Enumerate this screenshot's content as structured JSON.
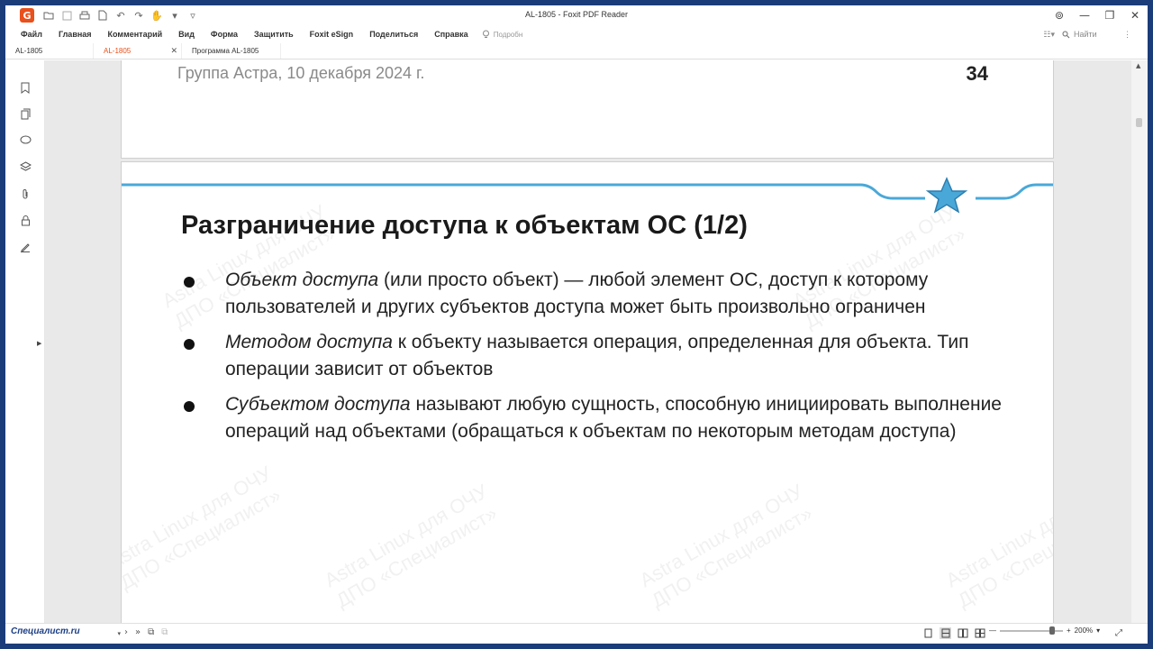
{
  "window": {
    "title": "AL-1805 - Foxit PDF Reader",
    "app_logo_letter": "G"
  },
  "menu": {
    "items": [
      "Файл",
      "Главная",
      "Комментарий",
      "Вид",
      "Форма",
      "Защитить",
      "Foxit eSign",
      "Поделиться",
      "Справка"
    ],
    "tell_me": "Подробн",
    "find_placeholder": "Найти"
  },
  "tabs": [
    {
      "label": "AL-1805",
      "active": false
    },
    {
      "label": "AL-1805",
      "active": true
    },
    {
      "label": "Программа AL-1805",
      "active": false
    }
  ],
  "document": {
    "prev_page": {
      "header_left": "Группа Астра, 10 декабря 2024 г.",
      "page_number": "34"
    },
    "slide": {
      "title": "Разграничение доступа к объектам ОС (1/2)",
      "bullets": [
        {
          "term": "Объект доступа",
          "text": " (или просто объект) — любой элемент ОС, доступ к которому пользователей и других субъектов доступа может быть произвольно ограничен"
        },
        {
          "term": "Методом доступа",
          "text": " к объекту называется операция, определенная для объекта. Тип операции зависит от объектов"
        },
        {
          "term": "Субъектом доступа",
          "text": " называют любую сущность, способную инициировать выполнение операций над объектами (обращаться к объектам по некоторым методам доступа)"
        }
      ],
      "accent_color": "#4aa8d8"
    }
  },
  "status": {
    "brand": "Специалист.ru",
    "zoom": "200%"
  }
}
